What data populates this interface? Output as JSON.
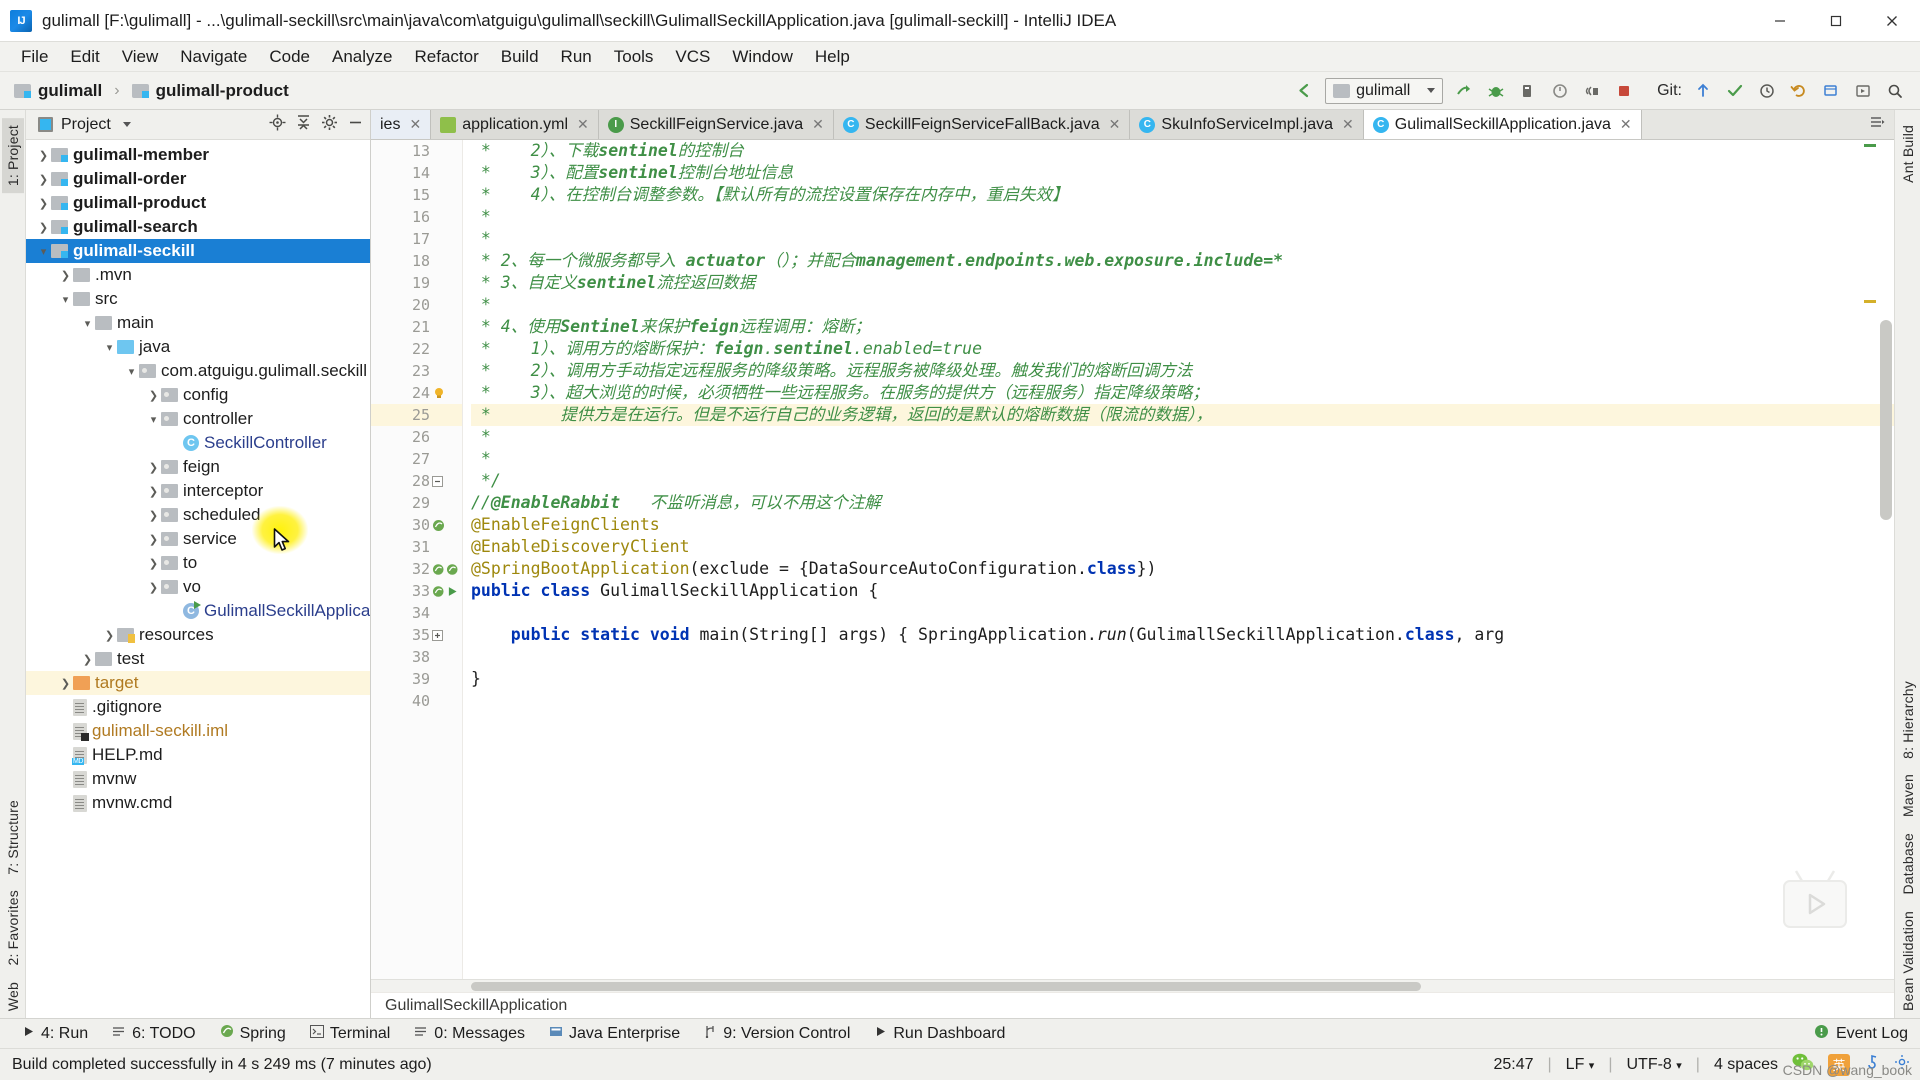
{
  "window": {
    "title": "gulimall [F:\\gulimall] - ...\\gulimall-seckill\\src\\main\\java\\com\\atguigu\\gulimall\\seckill\\GulimallSeckillApplication.java [gulimall-seckill] - IntelliJ IDEA",
    "logo_text": "IJ",
    "minimize_label": "Minimize",
    "maximize_label": "Maximize",
    "close_label": "Close"
  },
  "menubar": {
    "items": [
      {
        "label": "File"
      },
      {
        "label": "Edit"
      },
      {
        "label": "View"
      },
      {
        "label": "Navigate"
      },
      {
        "label": "Code"
      },
      {
        "label": "Analyze"
      },
      {
        "label": "Refactor"
      },
      {
        "label": "Build"
      },
      {
        "label": "Run"
      },
      {
        "label": "Tools"
      },
      {
        "label": "VCS"
      },
      {
        "label": "Window"
      },
      {
        "label": "Help"
      }
    ]
  },
  "navbar": {
    "breadcrumb": [
      "gulimall",
      "gulimall-product"
    ],
    "run_config": "gulimall",
    "git_label": "Git:",
    "icons": [
      "back-arrow-icon",
      "run-icon",
      "debug-icon",
      "run-with-coverage-icon",
      "profiler-icon",
      "attach-icon",
      "stop-icon"
    ]
  },
  "left_strip": {
    "tabs": [
      {
        "label": "1: Project",
        "selected": true
      },
      {
        "label": "7: Structure",
        "selected": false
      },
      {
        "label": "2: Favorites",
        "selected": false
      },
      {
        "label": "Web",
        "selected": false
      }
    ]
  },
  "right_strip": {
    "tabs": [
      {
        "label": "Ant Build"
      },
      {
        "label": "8: Hierarchy"
      },
      {
        "label": "Maven"
      },
      {
        "label": "Database"
      },
      {
        "label": "Bean Validation"
      }
    ]
  },
  "project_panel": {
    "title": "Project",
    "header_icons": [
      "locate-icon",
      "collapse-all-icon",
      "settings-gear-icon",
      "hide-icon"
    ],
    "tree": [
      {
        "indent": 0,
        "arrow": "right",
        "icon": "module-folder",
        "label": "gulimall-member",
        "bold": true,
        "color": "black"
      },
      {
        "indent": 0,
        "arrow": "right",
        "icon": "module-folder",
        "label": "gulimall-order",
        "bold": true,
        "color": "black"
      },
      {
        "indent": 0,
        "arrow": "right",
        "icon": "module-folder",
        "label": "gulimall-product",
        "bold": true,
        "color": "black"
      },
      {
        "indent": 0,
        "arrow": "right",
        "icon": "module-folder",
        "label": "gulimall-search",
        "bold": true,
        "color": "black"
      },
      {
        "indent": 0,
        "arrow": "down",
        "icon": "module-folder",
        "label": "gulimall-seckill",
        "bold": true,
        "color": "white",
        "selected": true
      },
      {
        "indent": 1,
        "arrow": "right",
        "icon": "folder",
        "label": ".mvn",
        "bold": false,
        "color": "black"
      },
      {
        "indent": 1,
        "arrow": "down",
        "icon": "folder",
        "label": "src",
        "bold": false,
        "color": "black"
      },
      {
        "indent": 2,
        "arrow": "down",
        "icon": "folder",
        "label": "main",
        "bold": false,
        "color": "black"
      },
      {
        "indent": 3,
        "arrow": "down",
        "icon": "source-folder",
        "label": "java",
        "bold": false,
        "color": "black"
      },
      {
        "indent": 4,
        "arrow": "down",
        "icon": "package",
        "label": "com.atguigu.gulimall.seckill",
        "bold": false,
        "color": "black"
      },
      {
        "indent": 5,
        "arrow": "right",
        "icon": "package",
        "label": "config",
        "bold": false,
        "color": "black"
      },
      {
        "indent": 5,
        "arrow": "down",
        "icon": "package",
        "label": "controller",
        "bold": false,
        "color": "black"
      },
      {
        "indent": 6,
        "arrow": "none",
        "icon": "class",
        "label": "SeckillController",
        "bold": false,
        "color": "blue"
      },
      {
        "indent": 5,
        "arrow": "right",
        "icon": "package",
        "label": "feign",
        "bold": false,
        "color": "black"
      },
      {
        "indent": 5,
        "arrow": "right",
        "icon": "package",
        "label": "interceptor",
        "bold": false,
        "color": "black"
      },
      {
        "indent": 5,
        "arrow": "right",
        "icon": "package",
        "label": "scheduled",
        "bold": false,
        "color": "black"
      },
      {
        "indent": 5,
        "arrow": "right",
        "icon": "package",
        "label": "service",
        "bold": false,
        "color": "black"
      },
      {
        "indent": 5,
        "arrow": "right",
        "icon": "package",
        "label": "to",
        "bold": false,
        "color": "black"
      },
      {
        "indent": 5,
        "arrow": "right",
        "icon": "package",
        "label": "vo",
        "bold": false,
        "color": "black"
      },
      {
        "indent": 6,
        "arrow": "none",
        "icon": "spring-class",
        "label": "GulimallSeckillApplication",
        "bold": false,
        "color": "blue"
      },
      {
        "indent": 3,
        "arrow": "right",
        "icon": "resource-folder",
        "label": "resources",
        "bold": false,
        "color": "black"
      },
      {
        "indent": 2,
        "arrow": "right",
        "icon": "folder",
        "label": "test",
        "bold": false,
        "color": "black"
      },
      {
        "indent": 1,
        "arrow": "right",
        "icon": "target-folder",
        "label": "target",
        "bold": false,
        "color": "orange",
        "highlight": true
      },
      {
        "indent": 1,
        "arrow": "none",
        "icon": "file",
        "label": ".gitignore",
        "bold": false,
        "color": "black"
      },
      {
        "indent": 1,
        "arrow": "none",
        "icon": "iml-file",
        "label": "gulimall-seckill.iml",
        "bold": false,
        "color": "orange"
      },
      {
        "indent": 1,
        "arrow": "none",
        "icon": "md-file",
        "label": "HELP.md",
        "bold": false,
        "color": "black"
      },
      {
        "indent": 1,
        "arrow": "none",
        "icon": "file",
        "label": "mvnw",
        "bold": false,
        "color": "black"
      },
      {
        "indent": 1,
        "arrow": "none",
        "icon": "file",
        "label": "mvnw.cmd",
        "bold": false,
        "color": "black"
      }
    ]
  },
  "editor": {
    "tabs": [
      {
        "label": "ies",
        "icon": "none",
        "active": false,
        "partial": true
      },
      {
        "label": "application.yml",
        "icon": "yml-icon",
        "active": false
      },
      {
        "label": "SeckillFeignService.java",
        "icon": "interface-icon",
        "active": false
      },
      {
        "label": "SeckillFeignServiceFallBack.java",
        "icon": "class-icon",
        "active": false
      },
      {
        "label": "SkuInfoServiceImpl.java",
        "icon": "class-icon",
        "active": false
      },
      {
        "label": "GulimallSeckillApplication.java",
        "icon": "class-icon",
        "active": true
      }
    ],
    "breadcrumb_bottom": "GulimallSeckillApplication",
    "lines": [
      {
        "n": "13",
        "text": " *    2）、下载sentinel的控制台",
        "type": "comment"
      },
      {
        "n": "14",
        "text": " *    3）、配置sentinel控制台地址信息",
        "type": "comment"
      },
      {
        "n": "15",
        "text": " *    4）、在控制台调整参数。【默认所有的流控设置保存在内存中，重启失效】",
        "type": "comment"
      },
      {
        "n": "16",
        "text": " *",
        "type": "comment"
      },
      {
        "n": "17",
        "text": " *",
        "type": "comment"
      },
      {
        "n": "18",
        "text": " * 2、每一个微服务都导入 actuator（）；并配合management.endpoints.web.exposure.include=*",
        "type": "comment"
      },
      {
        "n": "19",
        "text": " * 3、自定义sentinel流控返回数据",
        "type": "comment"
      },
      {
        "n": "20",
        "text": " *",
        "type": "comment"
      },
      {
        "n": "21",
        "text": " * 4、使用Sentinel来保护feign远程调用：熔断；",
        "type": "comment"
      },
      {
        "n": "22",
        "text": " *    1）、调用方的熔断保护：feign.sentinel.enabled=true",
        "type": "comment"
      },
      {
        "n": "23",
        "text": " *    2）、调用方手动指定远程服务的降级策略。远程服务被降级处理。触发我们的熔断回调方法",
        "type": "comment"
      },
      {
        "n": "24",
        "text": " *    3）、超大浏览的时候，必须牺牲一些远程服务。在服务的提供方（远程服务）指定降级策略；",
        "type": "comment"
      },
      {
        "n": "25",
        "text": " *       提供方是在运行。但是不运行自己的业务逻辑，返回的是默认的熔断数据（限流的数据），",
        "type": "comment",
        "highlight": true
      },
      {
        "n": "26",
        "text": " *",
        "type": "comment"
      },
      {
        "n": "27",
        "text": " *",
        "type": "comment"
      },
      {
        "n": "28",
        "text": " */",
        "type": "comment"
      },
      {
        "n": "29",
        "text": "//@EnableRabbit   不监听消息，可以不用这个注解",
        "type": "comment"
      },
      {
        "n": "30",
        "text": "@EnableFeignClients",
        "type": "annotation"
      },
      {
        "n": "31",
        "text": "@EnableDiscoveryClient",
        "type": "annotation"
      },
      {
        "n": "32",
        "text": "@SpringBootApplication(exclude = {DataSourceAutoConfiguration.class})",
        "type": "annotation-complex"
      },
      {
        "n": "33",
        "text": "public class GulimallSeckillApplication {",
        "type": "class-decl"
      },
      {
        "n": "34",
        "text": "",
        "type": "blank"
      },
      {
        "n": "35",
        "text": "    public static void main(String[] args) { SpringApplication.run(GulimallSeckillApplication.class, arg",
        "type": "method"
      },
      {
        "n": "38",
        "text": "",
        "type": "blank"
      },
      {
        "n": "39",
        "text": "}",
        "type": "code"
      },
      {
        "n": "40",
        "text": "",
        "type": "blank"
      }
    ]
  },
  "bottom_toolbar": {
    "items": [
      {
        "icon": "run-icon",
        "label": "4: Run"
      },
      {
        "icon": "todo-icon",
        "label": "6: TODO"
      },
      {
        "icon": "spring-icon",
        "label": "Spring"
      },
      {
        "icon": "terminal-icon",
        "label": "Terminal"
      },
      {
        "icon": "messages-icon",
        "label": "0: Messages"
      },
      {
        "icon": "java-ee-icon",
        "label": "Java Enterprise"
      },
      {
        "icon": "vcs-icon",
        "label": "9: Version Control"
      },
      {
        "icon": "dashboard-icon",
        "label": "Run Dashboard"
      }
    ],
    "event_log": "Event Log"
  },
  "statusbar": {
    "message": "Build completed successfully in 4 s 249 ms (7 minutes ago)",
    "caret": "25:47",
    "line_sep": "LF",
    "encoding": "UTF-8",
    "indent": "4 spaces",
    "ime": "英",
    "watermark": "CSDN @wang_book"
  },
  "colors": {
    "accent_blue": "#1a7fd4",
    "comment_green": "#3f8f46",
    "keyword_blue": "#0033b3",
    "annotation_gold": "#9e880d",
    "highlight_yellow": "#fdf6dd",
    "cursor_glow": "#fff200"
  }
}
